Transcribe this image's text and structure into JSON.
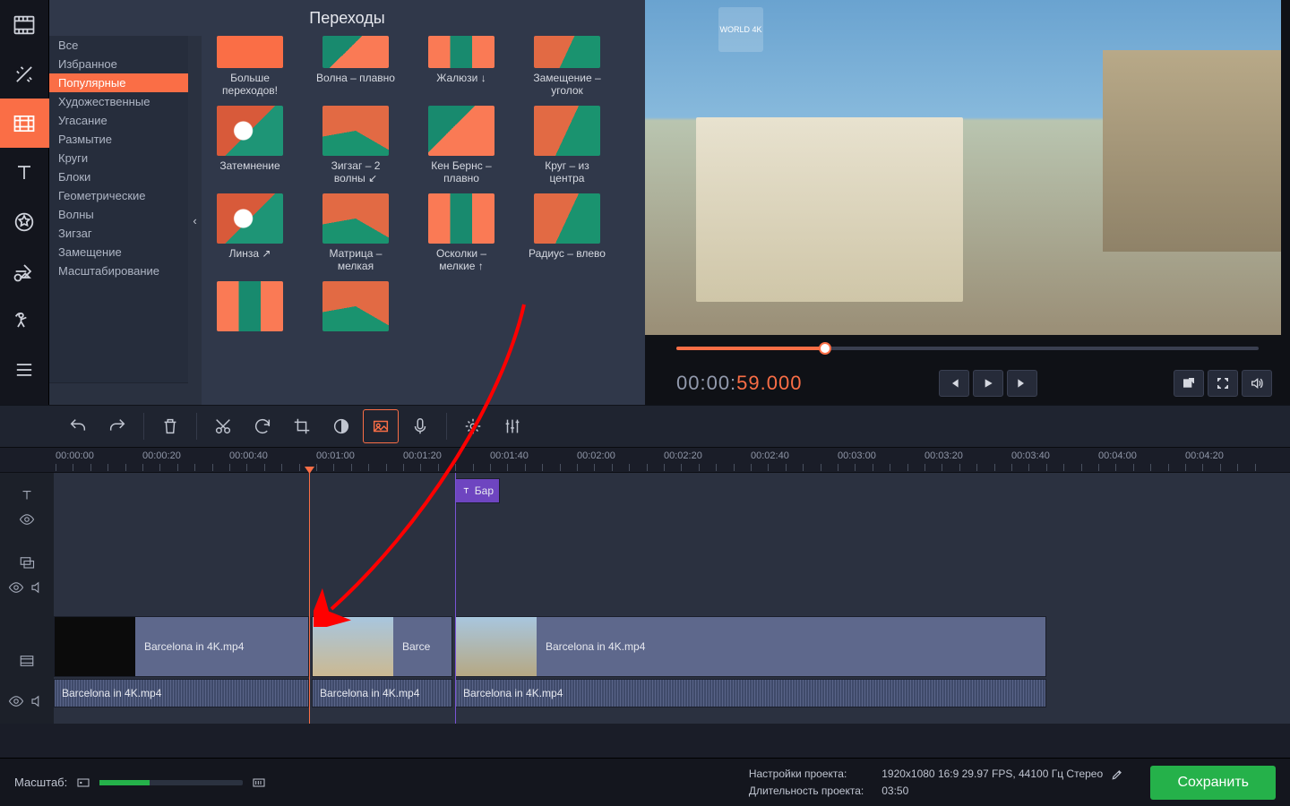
{
  "browser": {
    "title": "Переходы",
    "categories": [
      "Все",
      "Избранное",
      "Популярные",
      "Художественные",
      "Угасание",
      "Размытие",
      "Круги",
      "Блоки",
      "Геометрические",
      "Волны",
      "Зигзаг",
      "Замещение",
      "Масштабирование"
    ],
    "selected_index": 2,
    "search_placeholder": "",
    "items_row0": [
      {
        "label": "Больше переходов!"
      },
      {
        "label": "Волна – плавно"
      },
      {
        "label": "Жалюзи ↓"
      },
      {
        "label": "Замещение – уголок"
      }
    ],
    "items_row1": [
      {
        "label": "Затемнение"
      },
      {
        "label": "Зигзаг – 2 волны ↙"
      },
      {
        "label": "Кен Бернс – плавно"
      },
      {
        "label": "Круг – из центра"
      }
    ],
    "items_row2": [
      {
        "label": "Линза ↗"
      },
      {
        "label": "Матрица – мелкая"
      },
      {
        "label": "Осколки – мелкие ↑"
      },
      {
        "label": "Радиус – влево"
      }
    ]
  },
  "preview": {
    "badge": "WORLD 4K",
    "timecode_prefix": "00:00:",
    "timecode_hl": "59.000"
  },
  "ruler": {
    "marks": [
      "00:00:00",
      "00:00:20",
      "00:00:40",
      "00:01:00",
      "00:01:20",
      "00:01:40",
      "00:02:00",
      "00:02:20",
      "00:02:40",
      "00:03:00",
      "00:03:20",
      "00:03:40",
      "00:04:00",
      "00:04:20"
    ]
  },
  "timeline": {
    "title_clip": "Бар",
    "clip1_label": "Barcelona in 4K.mp4",
    "clip2_label": "Barce",
    "clip3_label": "Barcelona in 4K.mp4",
    "audio1": "Barcelona in 4K.mp4",
    "audio2": "Barcelona in 4K.mp4",
    "audio3": "Barcelona in 4K.mp4"
  },
  "footer": {
    "zoom_label": "Масштаб:",
    "settings_label": "Настройки проекта:",
    "settings_value": "1920x1080 16:9 29.97 FPS, 44100 Гц Стерео",
    "duration_label": "Длительность проекта:",
    "duration_value": "03:50",
    "save": "Сохранить"
  }
}
